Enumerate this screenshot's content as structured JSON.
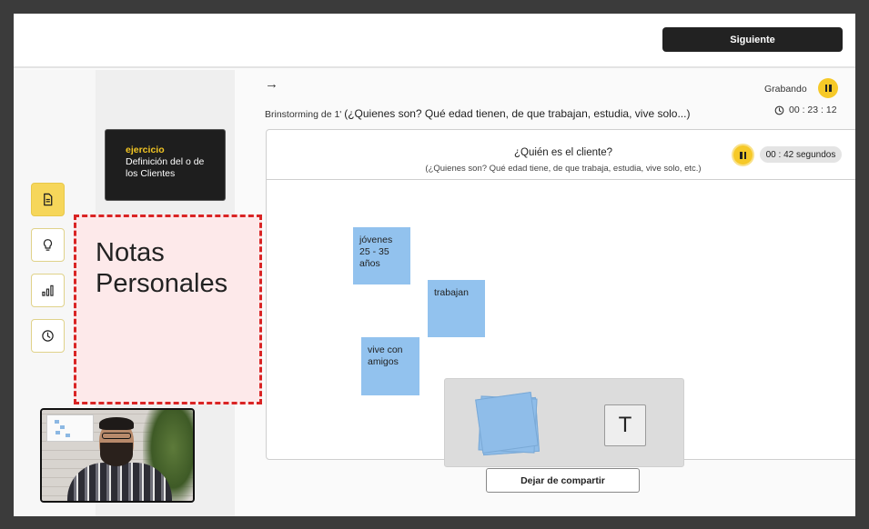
{
  "topbar": {
    "next_label": "Siguiente"
  },
  "exercise": {
    "tag": "ejercicio",
    "text": "Definición del o de los Clientes"
  },
  "sidebar": {
    "items": [
      {
        "icon": "document-icon",
        "active": true
      },
      {
        "icon": "lightbulb-icon",
        "active": false
      },
      {
        "icon": "bar-chart-icon",
        "active": false
      },
      {
        "icon": "clock-icon",
        "active": false
      }
    ]
  },
  "notes": {
    "label": "Notas Personales"
  },
  "header": {
    "arrow": "→",
    "recording_label": "Grabando",
    "elapsed": "00 : 23 : 12",
    "breadcrumb_prefix": "Brinstorming de 1'",
    "breadcrumb_question": "(¿Quienes son? Qué edad tienen, de que trabajan, estudia, vive solo...)"
  },
  "board": {
    "title": "¿Quién es el cliente?",
    "subtitle": "(¿Quienes son? Qué edad tiene, de que trabaja, estudia, vive solo, etc.)",
    "timer": "00 : 42 segundos",
    "stickies": [
      {
        "text": "jóvenes 25 - 35 años"
      },
      {
        "text": "trabajan"
      },
      {
        "text": "vive con amigos"
      }
    ],
    "text_tool": "T"
  },
  "footer": {
    "stop_sharing_label": "Dejar de compartir"
  },
  "colors": {
    "accent": "#f6c928",
    "sticky": "#92c2ee",
    "dark": "#222222",
    "notes_border": "#d92424"
  }
}
